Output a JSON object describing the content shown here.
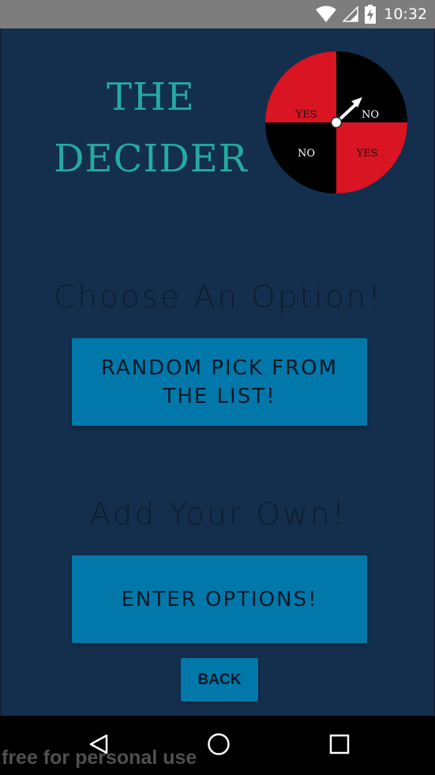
{
  "status_bar": {
    "time": "10:32",
    "icons": [
      "wifi-icon",
      "cell-signal-icon",
      "battery-charging-icon"
    ]
  },
  "app": {
    "title_line1": "THE",
    "title_line2": "DECIDER",
    "spinner": {
      "segments": [
        {
          "label": "YES",
          "color": "#d91423"
        },
        {
          "label": "NO",
          "color": "#000000"
        },
        {
          "label": "NO",
          "color": "#000000"
        },
        {
          "label": "YES",
          "color": "#d91423"
        }
      ]
    },
    "choose_heading": "Choose An Option!",
    "random_button_line1": "RANDOM PICK FROM",
    "random_button_line2": "THE LIST!",
    "add_heading": "Add Your Own!",
    "enter_button": "ENTER OPTIONS!",
    "back_button": "BACK"
  },
  "nav_bar": {
    "icons": [
      "back-triangle-icon",
      "home-circle-icon",
      "recents-square-icon"
    ]
  },
  "watermark": "free for personal use",
  "colors": {
    "background": "#142f4d",
    "title": "#26a9a4",
    "button": "#0178a9",
    "status_bar": "#7d7d7d"
  }
}
